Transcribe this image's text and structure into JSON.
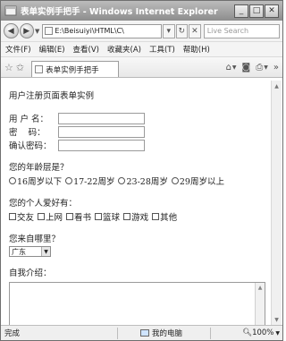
{
  "window": {
    "title": "表单实例手把手 - Windows Internet Explorer",
    "minimize": "_",
    "maximize": "□",
    "close": "✕"
  },
  "address": {
    "url": "E:\\Beisuiyi\\HTML\\C\\",
    "search_placeholder": "Live Search"
  },
  "menu": [
    "文件(F)",
    "编辑(E)",
    "查看(V)",
    "收藏夹(A)",
    "工具(T)",
    "帮助(H)"
  ],
  "tab": {
    "label": "表单实例手把手"
  },
  "form": {
    "heading": "用户注册页面表单实例",
    "username_label": "用 户 名：",
    "password_label": "密    码：",
    "confirm_label": "确认密码：",
    "age_question": "您的年龄层是？",
    "age_options": [
      "16周岁以下",
      "17-22周岁",
      "23-28周岁",
      "29周岁以上"
    ],
    "hobby_question": "您的个人爱好有：",
    "hobby_options": [
      "交友",
      "上网",
      "看书",
      "篮球",
      "游戏",
      "其他"
    ],
    "origin_question": "您来自哪里？",
    "origin_selected": "广东",
    "intro_label": "自我介绍："
  },
  "status": {
    "left": "完成",
    "zone": "我的电脑",
    "zoom": "100%"
  },
  "icons": {
    "back": "back-arrow-icon",
    "forward": "forward-arrow-icon",
    "refresh": "refresh-icon",
    "stop": "stop-icon",
    "home": "home-icon",
    "feeds": "feeds-icon",
    "print": "print-icon"
  }
}
